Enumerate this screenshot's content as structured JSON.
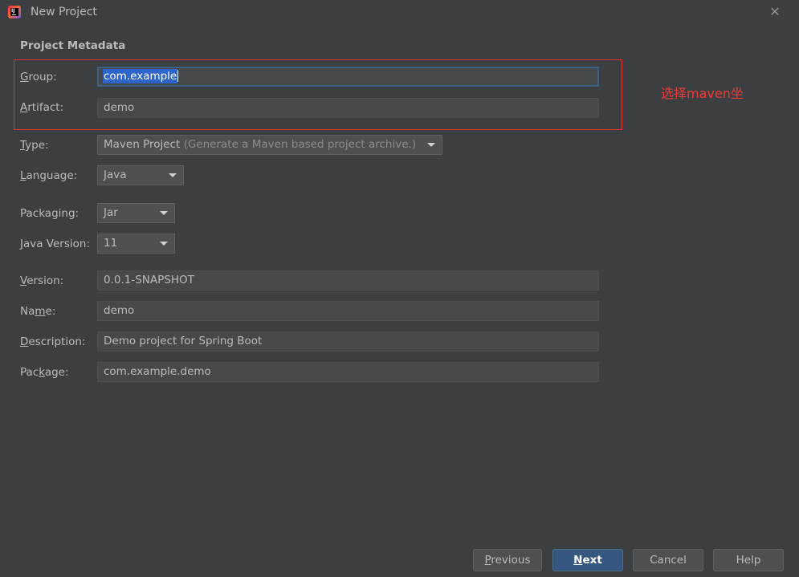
{
  "window": {
    "title": "New Project",
    "close_label": "✕"
  },
  "section": {
    "title": "Project Metadata"
  },
  "annotation": {
    "text": "选择maven坐",
    "color": "#ee3a36"
  },
  "fields": {
    "group": {
      "label_mnemonic": "G",
      "label_rest": "roup:",
      "value": "com.example"
    },
    "artifact": {
      "label_mnemonic": "A",
      "label_rest": "rtifact:",
      "value": "demo"
    },
    "type": {
      "label_mnemonic": "T",
      "label_rest": "ype:",
      "value": "Maven Project",
      "hint": "(Generate a Maven based project archive.)"
    },
    "language": {
      "label_mnemonic": "L",
      "label_rest": "anguage:",
      "value": "Java"
    },
    "packaging": {
      "label": "Packaging:",
      "value": "Jar"
    },
    "java_version": {
      "label_mnemonic": "J",
      "label_rest": "ava Version:",
      "value": "11"
    },
    "version": {
      "label_mnemonic": "V",
      "label_rest": "ersion:",
      "value": "0.0.1-SNAPSHOT"
    },
    "name": {
      "label_pre": "Na",
      "label_mnemonic": "m",
      "label_rest": "e:",
      "value": "demo"
    },
    "description": {
      "label_mnemonic": "D",
      "label_rest": "escription:",
      "value": "Demo project for Spring Boot"
    },
    "package": {
      "label_pre": "Pac",
      "label_mnemonic": "k",
      "label_rest": "age:",
      "value": "com.example.demo"
    }
  },
  "buttons": {
    "previous": {
      "mnemonic": "P",
      "rest": "revious"
    },
    "next": {
      "mnemonic": "N",
      "rest": "ext"
    },
    "cancel": "Cancel",
    "help": "Help"
  },
  "colors": {
    "background": "#3c3f41",
    "selection": "#2f65ca",
    "primary_button": "#365880",
    "annotation_border": "#e0322c"
  }
}
